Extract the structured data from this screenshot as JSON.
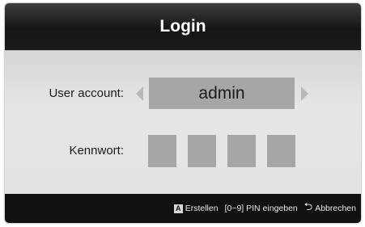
{
  "dialog": {
    "title": "Login"
  },
  "form": {
    "user_account_label": "User account:",
    "user_account_value": "admin",
    "password_label": "Kennwort:",
    "pin_digits": 4
  },
  "footer": {
    "a_key": "A",
    "create_label": "Erstellen",
    "pin_hint": "[0~9] PIN eingeben",
    "cancel_label": "Abbrechen"
  },
  "icons": {
    "left": "arrow-left-icon",
    "right": "arrow-right-icon",
    "return": "return-icon"
  }
}
